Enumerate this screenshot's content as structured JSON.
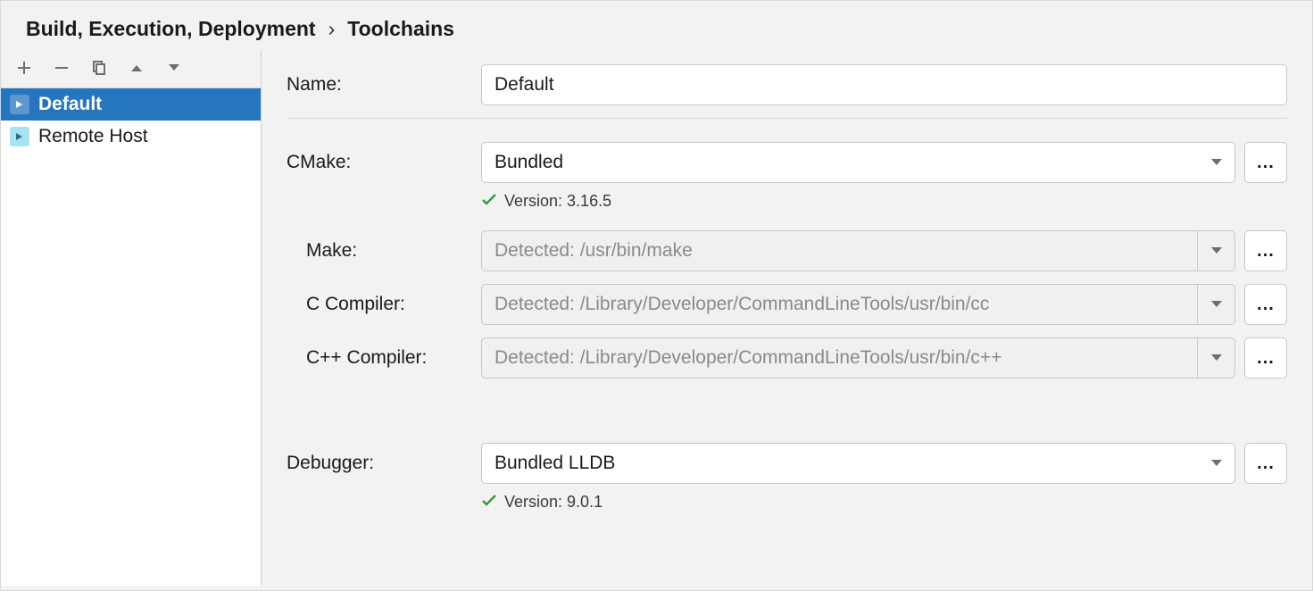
{
  "breadcrumb": {
    "root": "Build, Execution, Deployment",
    "leaf": "Toolchains"
  },
  "toolbar": {
    "add": "add",
    "remove": "remove",
    "copy": "copy",
    "up": "move-up",
    "down": "move-down"
  },
  "sidebar": {
    "items": [
      {
        "label": "Default",
        "selected": true
      },
      {
        "label": "Remote Host",
        "selected": false
      }
    ]
  },
  "form": {
    "name": {
      "label": "Name:",
      "value": "Default"
    },
    "cmake": {
      "label": "CMake:",
      "value": "Bundled",
      "browse": "...",
      "status": "Version: 3.16.5"
    },
    "make": {
      "label": "Make:",
      "placeholder": "Detected: /usr/bin/make",
      "browse": "..."
    },
    "c_compiler": {
      "label": "C Compiler:",
      "placeholder": "Detected: /Library/Developer/CommandLineTools/usr/bin/cc",
      "browse": "..."
    },
    "cpp_compiler": {
      "label": "C++ Compiler:",
      "placeholder": "Detected: /Library/Developer/CommandLineTools/usr/bin/c++",
      "browse": "..."
    },
    "debugger": {
      "label": "Debugger:",
      "value": "Bundled LLDB",
      "browse": "...",
      "status": "Version: 9.0.1"
    }
  }
}
